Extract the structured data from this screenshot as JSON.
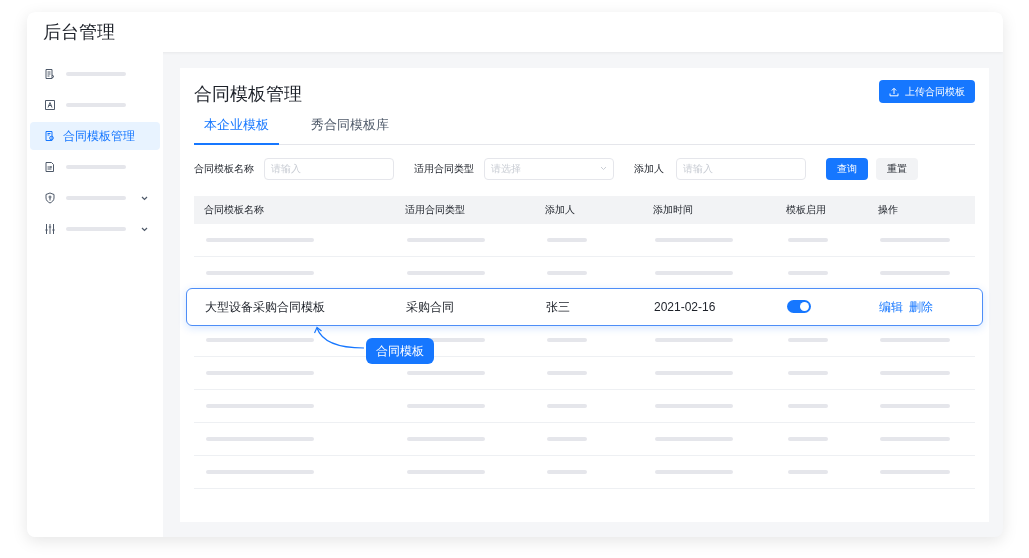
{
  "header": {
    "title": "后台管理"
  },
  "sidebar": {
    "items": [
      {
        "kind": "placeholder",
        "selected": false,
        "expandable": false
      },
      {
        "kind": "placeholder",
        "selected": false,
        "expandable": false
      },
      {
        "kind": "label",
        "label": "合同模板管理",
        "selected": true,
        "expandable": false
      },
      {
        "kind": "placeholder",
        "selected": false,
        "expandable": false
      },
      {
        "kind": "placeholder",
        "selected": false,
        "expandable": true
      },
      {
        "kind": "placeholder",
        "selected": false,
        "expandable": true
      }
    ]
  },
  "page": {
    "title": "合同模板管理",
    "upload_button": "上传合同模板"
  },
  "tabs": [
    {
      "label": "本企业模板",
      "selected": true
    },
    {
      "label": "秀合同模板库",
      "selected": false
    }
  ],
  "filters": [
    {
      "kind": "input",
      "label": "合同模板名称",
      "placeholder": "请输入"
    },
    {
      "kind": "select",
      "label": "适用合同类型",
      "placeholder": "请选择"
    },
    {
      "kind": "input",
      "label": "添加人",
      "placeholder": "请输入"
    }
  ],
  "filter_buttons": {
    "search": "查询",
    "reset": "重置"
  },
  "table": {
    "columns": [
      "合同模板名称",
      "适用合同类型",
      "添加人",
      "添加时间",
      "模板启用",
      "操作"
    ],
    "rows": [
      {
        "kind": "placeholder"
      },
      {
        "kind": "placeholder"
      },
      {
        "kind": "data",
        "name": "大型设备采购合同模板",
        "type": "采购合同",
        "creator": "张三",
        "date": "2021-02-16",
        "enabled": true,
        "actions": [
          "编辑",
          "删除"
        ]
      },
      {
        "kind": "placeholder"
      },
      {
        "kind": "placeholder"
      },
      {
        "kind": "placeholder"
      },
      {
        "kind": "placeholder"
      },
      {
        "kind": "placeholder"
      }
    ]
  },
  "callout": {
    "text": "合同模板"
  }
}
